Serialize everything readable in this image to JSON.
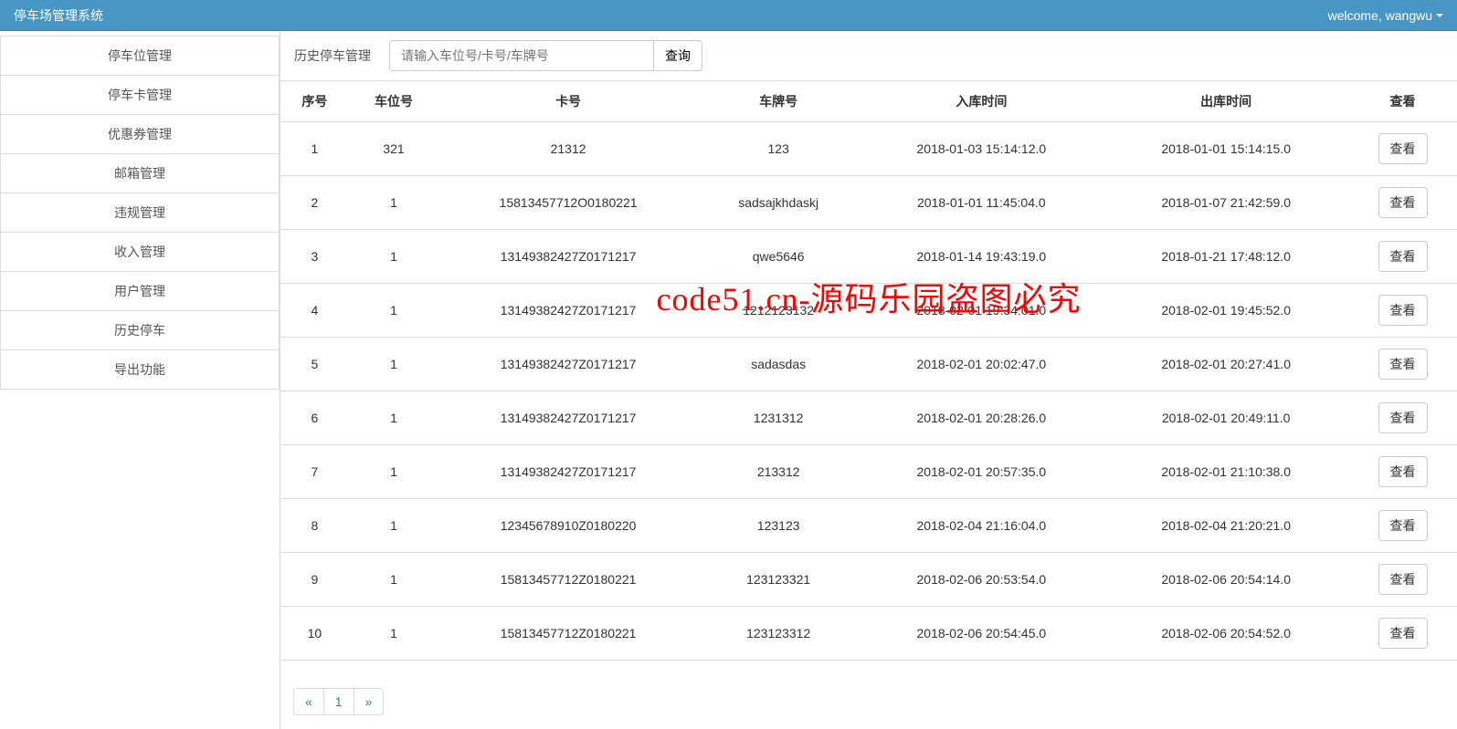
{
  "navbar": {
    "brand": "停车场管理系统",
    "welcome": "welcome, wangwu"
  },
  "sidebar": {
    "items": [
      "停车位管理",
      "停车卡管理",
      "优惠券管理",
      "邮箱管理",
      "违规管理",
      "收入管理",
      "用户管理",
      "历史停车",
      "导出功能"
    ]
  },
  "toolbar": {
    "title": "历史停车管理",
    "placeholder": "请输入车位号/卡号/车牌号",
    "search_label": "查询"
  },
  "table": {
    "headers": [
      "序号",
      "车位号",
      "卡号",
      "车牌号",
      "入库时间",
      "出库时间",
      "查看"
    ],
    "view_label": "查看",
    "rows": [
      {
        "seq": "1",
        "slot": "321",
        "card": "21312",
        "plate": "123",
        "in": "2018-01-03 15:14:12.0",
        "out": "2018-01-01 15:14:15.0"
      },
      {
        "seq": "2",
        "slot": "1",
        "card": "15813457712O0180221",
        "plate": "sadsajkhdaskj",
        "in": "2018-01-01 11:45:04.0",
        "out": "2018-01-07 21:42:59.0"
      },
      {
        "seq": "3",
        "slot": "1",
        "card": "13149382427Z0171217",
        "plate": "qwe5646",
        "in": "2018-01-14 19:43:19.0",
        "out": "2018-01-21 17:48:12.0"
      },
      {
        "seq": "4",
        "slot": "1",
        "card": "13149382427Z0171217",
        "plate": "1212123132",
        "in": "2018-02-01 19:34:01.0",
        "out": "2018-02-01 19:45:52.0"
      },
      {
        "seq": "5",
        "slot": "1",
        "card": "13149382427Z0171217",
        "plate": "sadasdas",
        "in": "2018-02-01 20:02:47.0",
        "out": "2018-02-01 20:27:41.0"
      },
      {
        "seq": "6",
        "slot": "1",
        "card": "13149382427Z0171217",
        "plate": "1231312",
        "in": "2018-02-01 20:28:26.0",
        "out": "2018-02-01 20:49:11.0"
      },
      {
        "seq": "7",
        "slot": "1",
        "card": "13149382427Z0171217",
        "plate": "213312",
        "in": "2018-02-01 20:57:35.0",
        "out": "2018-02-01 21:10:38.0"
      },
      {
        "seq": "8",
        "slot": "1",
        "card": "12345678910Z0180220",
        "plate": "123123",
        "in": "2018-02-04 21:16:04.0",
        "out": "2018-02-04 21:20:21.0"
      },
      {
        "seq": "9",
        "slot": "1",
        "card": "15813457712Z0180221",
        "plate": "123123321",
        "in": "2018-02-06 20:53:54.0",
        "out": "2018-02-06 20:54:14.0"
      },
      {
        "seq": "10",
        "slot": "1",
        "card": "15813457712Z0180221",
        "plate": "123123312",
        "in": "2018-02-06 20:54:45.0",
        "out": "2018-02-06 20:54:52.0"
      }
    ]
  },
  "pagination": {
    "prev": "«",
    "current": "1",
    "next": "»"
  },
  "watermark": "code51.cn-源码乐园盗图必究"
}
